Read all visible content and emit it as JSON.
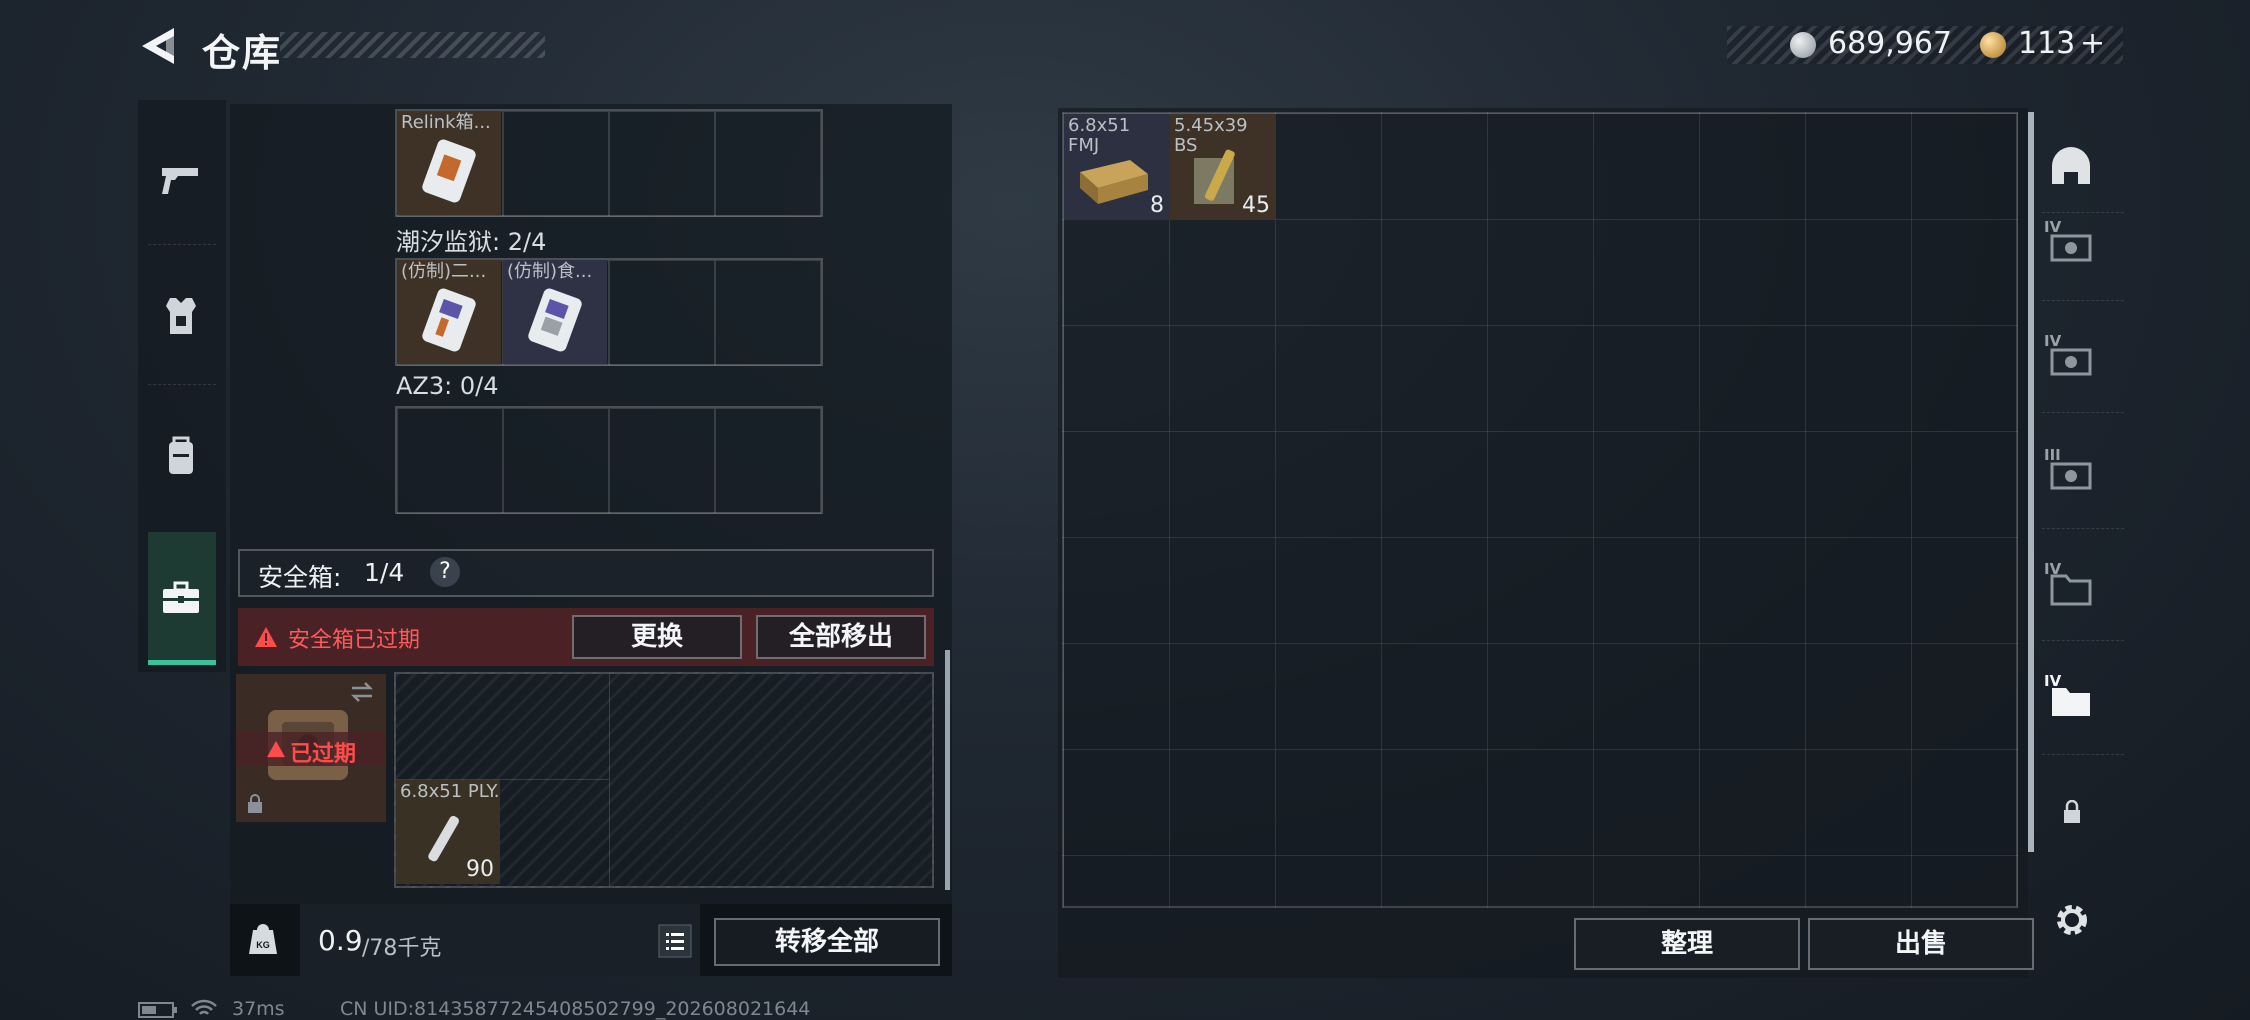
{
  "header": {
    "title": "仓库",
    "currency": [
      {
        "icon": "silver-coin-icon",
        "value": "689,967",
        "color": "#b8bec4"
      },
      {
        "icon": "gold-coin-icon",
        "value": "113",
        "color": "#d8aa55"
      }
    ],
    "plus_label": "+"
  },
  "left_nav": {
    "items": [
      {
        "icon": "pistol-icon"
      },
      {
        "icon": "armor-vest-icon"
      },
      {
        "icon": "backpack-icon"
      },
      {
        "icon": "briefcase-icon",
        "active": true
      }
    ]
  },
  "storage": {
    "sections": [
      {
        "label": "",
        "items": [
          {
            "name": "Relink箱..."
          }
        ]
      },
      {
        "label": "潮汐监狱: 2/4",
        "items": [
          {
            "name": "(仿制)二..."
          },
          {
            "name": "(仿制)食..."
          }
        ]
      },
      {
        "label": "AZ3: 0/4",
        "items": []
      }
    ]
  },
  "safebox": {
    "label": "安全箱:",
    "count": "1/4",
    "help": "?",
    "alert_text": "安全箱已过期",
    "replace_label": "更换",
    "remove_all_label": "全部移出",
    "expired_label": "已过期",
    "item": {
      "name": "6.8x51 PLY...",
      "count": "90"
    }
  },
  "bottom": {
    "weight": "0.9",
    "weight_max": "/78千克",
    "transfer_all_label": "转移全部"
  },
  "stash": {
    "items": [
      {
        "name": "6.8x51 FMJ",
        "count": "8"
      },
      {
        "name": "5.45x39 BS",
        "count": "45"
      }
    ],
    "sort_label": "整理",
    "sell_label": "出售"
  },
  "right_nav": {
    "items": [
      {
        "icon": "helmet-icon",
        "tier": ""
      },
      {
        "icon": "ammo-box-iv-icon",
        "tier": "IV"
      },
      {
        "icon": "ammo-box-iv-icon-2",
        "tier": "IV"
      },
      {
        "icon": "ammo-box-iii-icon",
        "tier": "III"
      },
      {
        "icon": "folder-iv-icon",
        "tier": "IV"
      },
      {
        "icon": "folder-iv-icon-2",
        "tier": "IV"
      }
    ]
  },
  "status_bar": {
    "ping": "37ms",
    "uid": "CN UID:81435877245408502799_202608021644"
  }
}
